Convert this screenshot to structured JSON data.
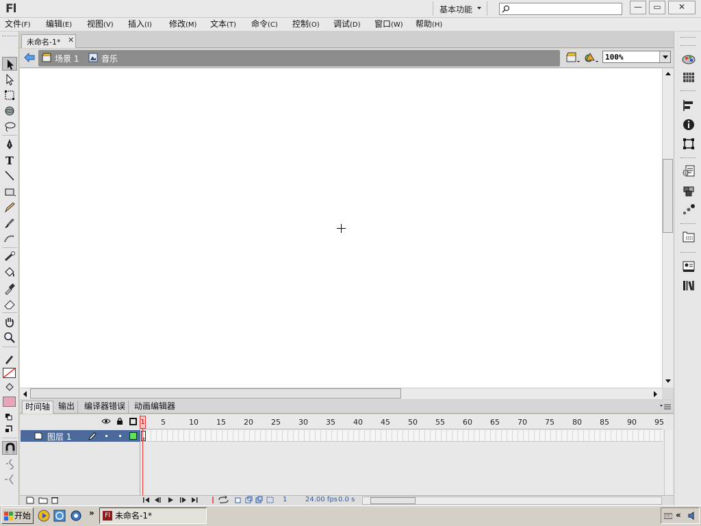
{
  "app": {
    "logo": "Fl"
  },
  "titlebar": {
    "workspace": "基本功能",
    "search_placeholder": "",
    "minimize": "—",
    "restore": "▭",
    "close": "✕"
  },
  "menu": [
    {
      "label": "文件",
      "key": "(F)"
    },
    {
      "label": "编辑",
      "key": "(E)"
    },
    {
      "label": "视图",
      "key": "(V)"
    },
    {
      "label": "插入",
      "key": "(I)"
    },
    {
      "label": "修改",
      "key": "(M)"
    },
    {
      "label": "文本",
      "key": "(T)"
    },
    {
      "label": "命令",
      "key": "(C)"
    },
    {
      "label": "控制",
      "key": "(O)"
    },
    {
      "label": "调试",
      "key": "(D)"
    },
    {
      "label": "窗口",
      "key": "(W)"
    },
    {
      "label": "帮助",
      "key": "(H)"
    }
  ],
  "document": {
    "tab_title": "未命名-1*",
    "tab_close": "✕",
    "breadcrumbs": [
      "场景 1",
      "音乐"
    ],
    "zoom": "100%"
  },
  "timeline": {
    "tabs": [
      "时间轴",
      "输出",
      "编译器错误",
      "动画编辑器"
    ],
    "frame_labels": [
      "1",
      "5",
      "10",
      "15",
      "20",
      "25",
      "30",
      "35",
      "40",
      "45",
      "50",
      "55",
      "60",
      "65",
      "70",
      "75",
      "80",
      "85",
      "90",
      "95"
    ],
    "layer_name": "图层 1",
    "current_frame": "1",
    "fps": "24.00 fps",
    "time": "0.0 s"
  },
  "taskbar": {
    "start": "开始",
    "task": "未命名-1*",
    "chevron": "»",
    "tray_chevron": "«"
  },
  "colors": {
    "selected_layer": "#4b6a9b",
    "playhead": "#e33333",
    "stage": "#ffffff",
    "layer_outline_swatch": "#5fe35a"
  }
}
